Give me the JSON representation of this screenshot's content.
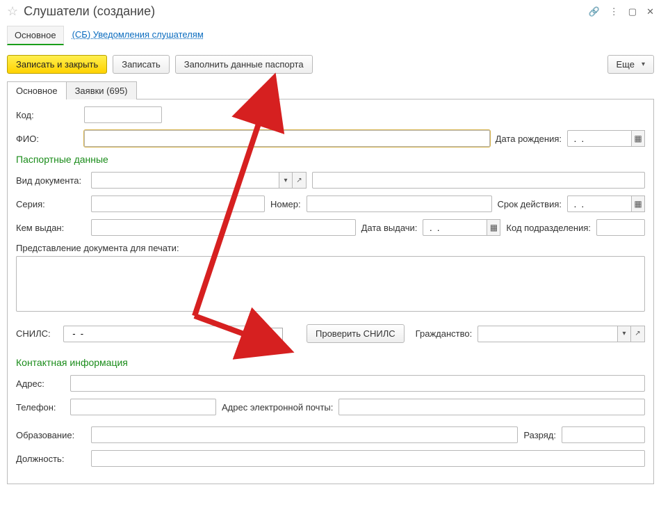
{
  "title": "Слушатели (создание)",
  "nav": {
    "main": "Основное",
    "link": "(СБ) Уведомления слушателям"
  },
  "toolbar": {
    "save_close": "Записать и закрыть",
    "save": "Записать",
    "fill_passport": "Заполнить данные паспорта",
    "more": "Еще"
  },
  "tabs": {
    "main": "Основное",
    "requests": "Заявки (695)"
  },
  "fields": {
    "code": "Код:",
    "fio": "ФИО:",
    "dob": "Дата рождения:",
    "dob_value": " .  .  ",
    "sec_passport": "Паспортные данные",
    "doc_type": "Вид документа:",
    "series": "Серия:",
    "number": "Номер:",
    "expiry": "Срок действия:",
    "expiry_value": " .  .  ",
    "issued_by": "Кем выдан:",
    "issue_date": "Дата выдачи:",
    "issue_date_value": " .  .  ",
    "dept_code": "Код подразделения:",
    "doc_repr": "Представление документа для печати:",
    "snils": "СНИЛС:",
    "snils_value": "  -  -",
    "check_snils": "Проверить СНИЛС",
    "citizenship": "Гражданство:",
    "sec_contact": "Контактная информация",
    "address": "Адрес:",
    "phone": "Телефон:",
    "email": "Адрес электронной почты:",
    "education": "Образование:",
    "grade": "Разряд:",
    "position": "Должность:"
  }
}
